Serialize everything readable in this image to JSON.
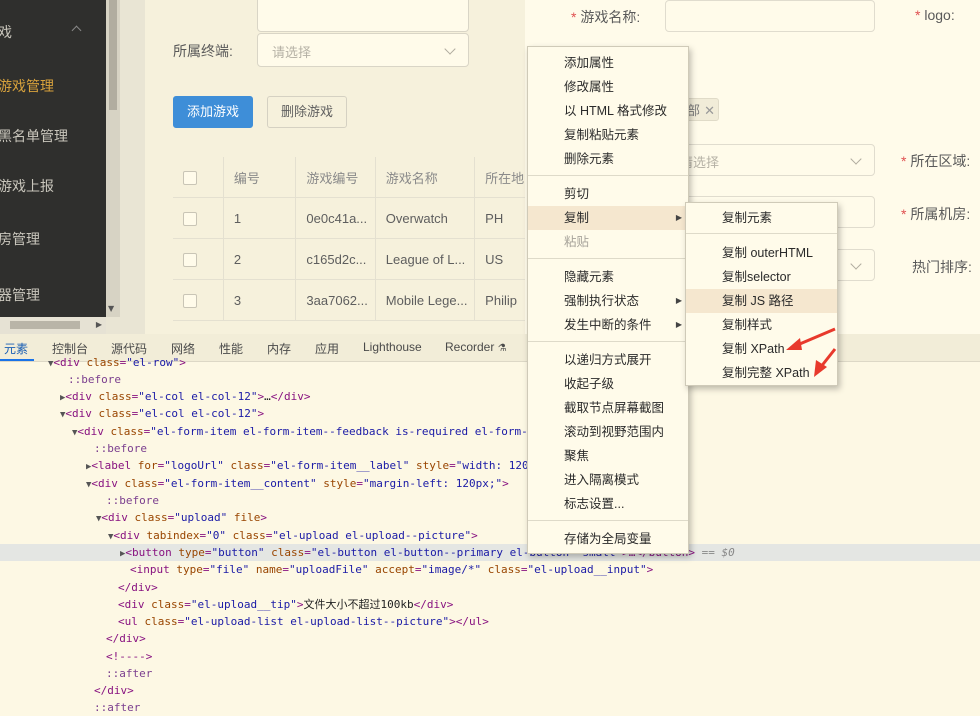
{
  "sidebar": {
    "items": [
      {
        "label": "戏",
        "active": false
      },
      {
        "label": "游戏管理",
        "active": true
      },
      {
        "label": "黑名单管理",
        "active": false
      },
      {
        "label": "游戏上报",
        "active": false
      },
      {
        "label": "房管理",
        "active": false
      },
      {
        "label": "器管理",
        "active": false
      }
    ]
  },
  "form": {
    "terminal_label": "所属终端:",
    "terminal_placeholder": "请选择",
    "add_button": "添加游戏",
    "delete_button": "删除游戏"
  },
  "table": {
    "headers": [
      "编号",
      "游戏编号",
      "游戏名称",
      "所在地"
    ],
    "rows": [
      {
        "id": "1",
        "code": "0e0c41a...",
        "name": "Overwatch",
        "region": "PH"
      },
      {
        "id": "2",
        "code": "c165d2c...",
        "name": "League of L...",
        "region": "US"
      },
      {
        "id": "3",
        "code": "3aa7062...",
        "name": "Mobile Lege...",
        "region": "Philip"
      }
    ]
  },
  "dialog_form": {
    "game_name_label": "游戏名称:",
    "logo_label": "logo:",
    "tag_text": "部",
    "select_placeholder": "请选择",
    "region_label": "所在区域:",
    "room_label": "所属机房:",
    "hot_sort_label": "热门排序:"
  },
  "devtools": {
    "tabs": [
      "元素",
      "控制台",
      "源代码",
      "网络",
      "性能",
      "内存",
      "应用",
      "Lighthouse",
      "Recorder"
    ],
    "active_tab": "元素",
    "dollar0": "== $0"
  },
  "context_menu": {
    "items": [
      {
        "label": "添加属性"
      },
      {
        "label": "修改属性"
      },
      {
        "label": "以 HTML 格式修改"
      },
      {
        "label": "复制粘贴元素"
      },
      {
        "label": "删除元素"
      },
      {
        "label": "剪切"
      },
      {
        "label": "复制"
      },
      {
        "label": "粘贴"
      },
      {
        "label": "隐藏元素"
      },
      {
        "label": "强制执行状态"
      },
      {
        "label": "发生中断的条件"
      },
      {
        "label": "以递归方式展开"
      },
      {
        "label": "收起子级"
      },
      {
        "label": "截取节点屏幕截图"
      },
      {
        "label": "滚动到视野范围内"
      },
      {
        "label": "聚焦"
      },
      {
        "label": "进入隔离模式"
      },
      {
        "label": "标志设置..."
      },
      {
        "label": "存储为全局变量"
      }
    ]
  },
  "copy_submenu": {
    "items": [
      {
        "label": "复制元素"
      },
      {
        "label": "复制 outerHTML"
      },
      {
        "label": "复制selector"
      },
      {
        "label": "复制 JS 路径"
      },
      {
        "label": "复制样式"
      },
      {
        "label": "复制 XPath"
      },
      {
        "label": "复制完整 XPath"
      }
    ]
  },
  "colors": {
    "sidebar_bg": "#2f2f2d",
    "active_menu": "#d8a23c",
    "primary": "#3e8ed8",
    "arrow_red": "#e8392c",
    "highlight": "#f5e7cf"
  }
}
